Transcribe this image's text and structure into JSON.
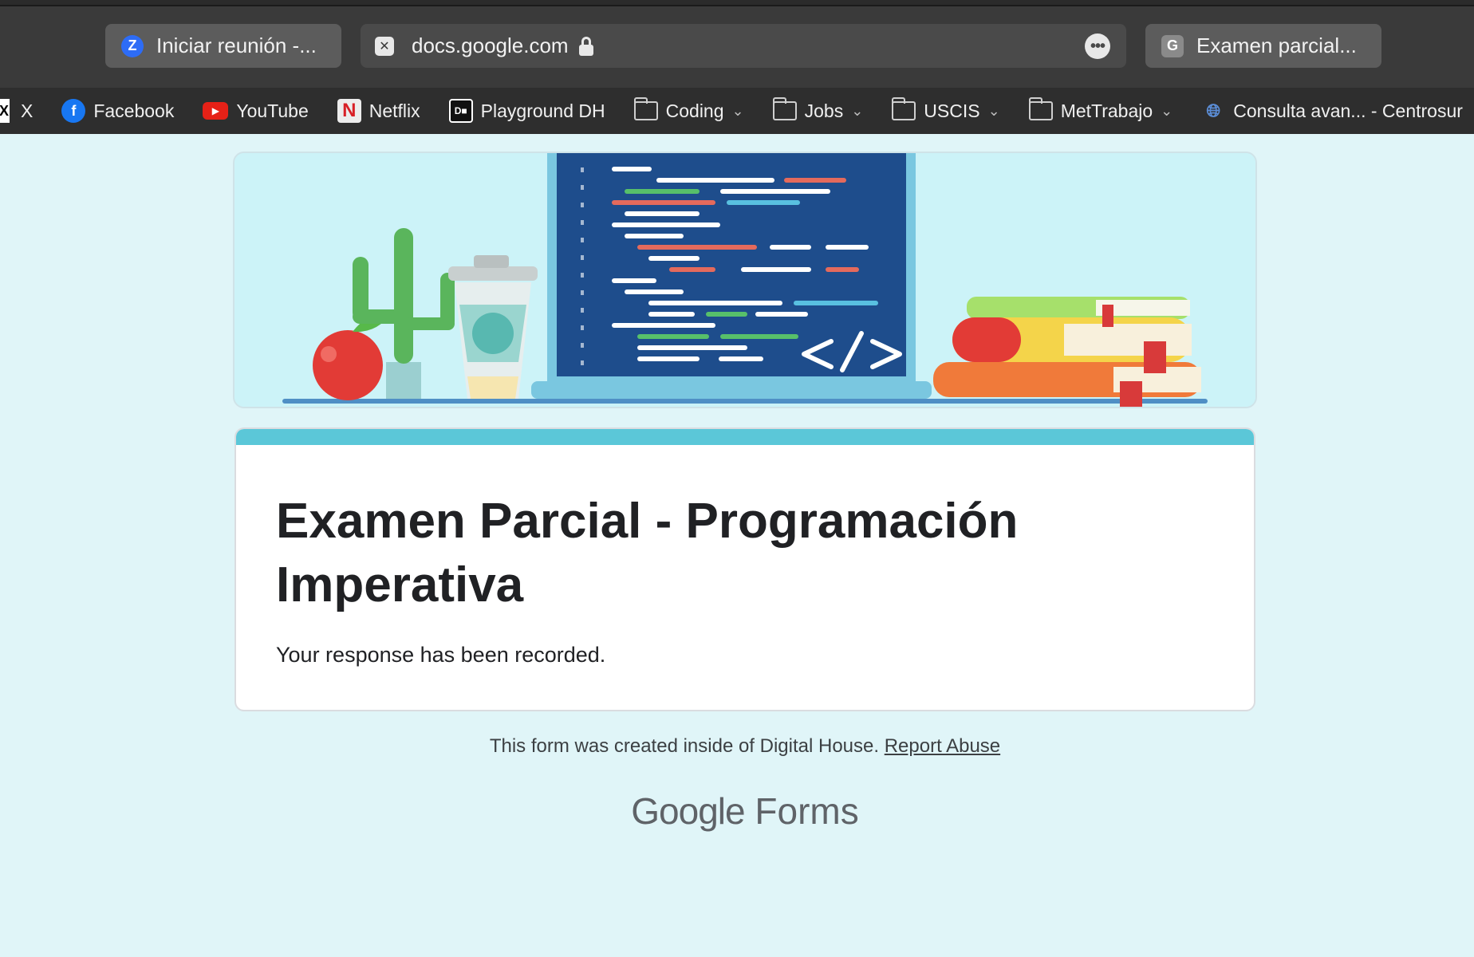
{
  "browser": {
    "tabs": [
      {
        "label": "Iniciar reunión -...",
        "icon": "zoom-icon"
      },
      {
        "label": "Examen parcial...",
        "icon": "google-forms-icon"
      }
    ],
    "address_bar": {
      "url": "docs.google.com"
    }
  },
  "bookmarks": [
    {
      "label": "X",
      "icon": "x-icon"
    },
    {
      "label": "Facebook",
      "icon": "facebook-icon"
    },
    {
      "label": "YouTube",
      "icon": "youtube-icon"
    },
    {
      "label": "Netflix",
      "icon": "netflix-icon"
    },
    {
      "label": "Playground DH",
      "icon": "digital-house-icon"
    },
    {
      "label": "Coding",
      "icon": "folder-icon"
    },
    {
      "label": "Jobs",
      "icon": "folder-icon"
    },
    {
      "label": "USCIS",
      "icon": "folder-icon"
    },
    {
      "label": "MetTrabajo",
      "icon": "folder-icon"
    },
    {
      "label": "Consulta avan... - Centrosur",
      "icon": "globe-icon"
    }
  ],
  "form": {
    "title": "Examen Parcial - Programación Imperativa",
    "message": "Your response has been recorded.",
    "accent_color": "#5bc7d8"
  },
  "footer": {
    "note": "This form was created inside of Digital House.",
    "report_link": "Report Abuse",
    "brand_google": "Google",
    "brand_forms": "Forms"
  },
  "colors": {
    "page_background": "#e0f5f8",
    "browser_toolbar": "#3a3a3a"
  }
}
